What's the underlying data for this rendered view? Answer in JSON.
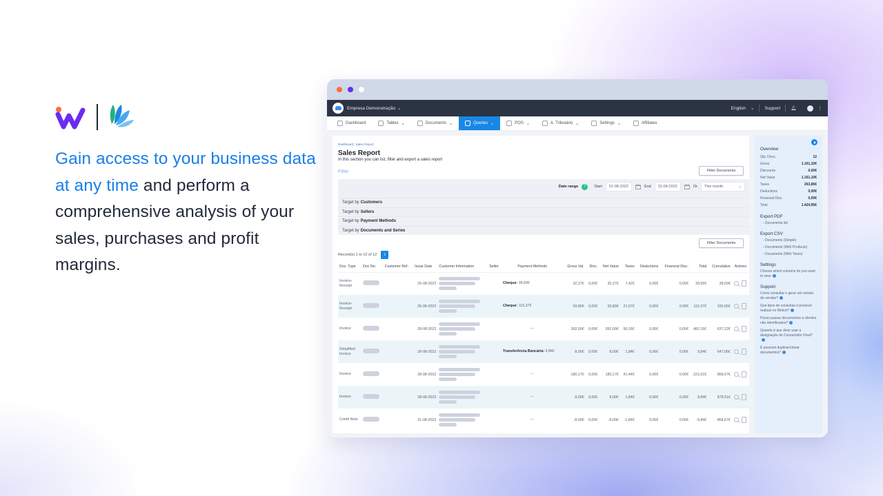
{
  "marketing": {
    "headline_highlight": "Gain access to your business data at any time",
    "headline_rest": " and perform a comprehensive analysis of your sales, purchases and profit margins.",
    "colors": {
      "highlight": "#1b7ee8",
      "text": "#232a3b",
      "brand_purple": "#6a2cf0",
      "brand_orange": "#ff6b35"
    }
  },
  "window": {
    "company": "Empresa Demonstração",
    "topnav": {
      "language": "English",
      "support": "Support"
    },
    "menu": [
      {
        "label": "Dashboard",
        "icon": "dashboard-icon",
        "dropdown": false,
        "active": false
      },
      {
        "label": "Tables",
        "icon": "users-icon",
        "dropdown": true,
        "active": false
      },
      {
        "label": "Documents",
        "icon": "document-icon",
        "dropdown": true,
        "active": false
      },
      {
        "label": "Queries",
        "icon": "bar-chart-icon",
        "dropdown": true,
        "active": true
      },
      {
        "label": "POS",
        "icon": "pos-icon",
        "dropdown": true,
        "active": false
      },
      {
        "label": "A. Tributário",
        "icon": "tax-icon",
        "dropdown": true,
        "active": false
      },
      {
        "label": "Settings",
        "icon": "settings-icon",
        "dropdown": true,
        "active": false
      },
      {
        "label": "Affiliates",
        "icon": "handshake-icon",
        "dropdown": false,
        "active": false
      }
    ],
    "breadcrumb": [
      "Dashboard",
      "Sales Report"
    ],
    "page_title": "Sales Report",
    "page_subtitle": "In this section you can list, filter and export a sales report",
    "filter_label": "Filter",
    "filter_button": "Filter Documents",
    "date_range": {
      "label": "Date range",
      "help": "?",
      "start_label": "Start",
      "start": "01-08-2022",
      "end_label": "End",
      "end": "31-08-2022",
      "or_label": "Or",
      "preset": "This month"
    },
    "targets": [
      {
        "prefix": "Target by",
        "label": "Customers"
      },
      {
        "prefix": "Target by",
        "label": "Sellers"
      },
      {
        "prefix": "Target by",
        "label": "Payment Methods"
      },
      {
        "prefix": "Target by",
        "label": "Documents and Series"
      }
    ],
    "records_text": "Record(s) 1 to 12 of 12",
    "current_page": "1",
    "table": {
      "columns": [
        "Doc. Type",
        "Doc No.",
        "Customer Ref.",
        "Issue Date",
        "Customer Information",
        "Seller",
        "Payment Methods",
        "Gross Val.",
        "Disc.",
        "Net Value",
        "Taxes",
        "Deductions",
        "Financial Disc.",
        "Total",
        "Cumulative",
        "Actions"
      ],
      "rows": [
        {
          "type": "Invoice-Receipt",
          "date": "25-08-2022",
          "pm_label": "Cheque:",
          "pm_value": "39,69€",
          "gross": "32,27€",
          "disc": "0,00€",
          "net": "32,27€",
          "taxes": "7,42€",
          "deductions": "0,00€",
          "fin_disc": "0,00€",
          "total": "39,69€",
          "cumulative": "39,69€"
        },
        {
          "type": "Invoice-Receipt",
          "date": "26-08-2022",
          "pm_label": "Cheque:",
          "pm_value": "115,37€",
          "gross": "93,80€",
          "disc": "0,00€",
          "net": "93,80€",
          "taxes": "21,57€",
          "deductions": "0,00€",
          "fin_disc": "0,00€",
          "total": "115,37€",
          "cumulative": "155,06€"
        },
        {
          "type": "Invoice",
          "date": "28-08-2022",
          "pm_label": "",
          "pm_value": "---",
          "gross": "392,00€",
          "disc": "0,00€",
          "net": "392,00€",
          "taxes": "90,16€",
          "deductions": "0,00€",
          "fin_disc": "0,00€",
          "total": "482,16€",
          "cumulative": "637,22€"
        },
        {
          "type": "Simplified Invoice",
          "date": "28-08-2022",
          "pm_label": "Transferência Bancária:",
          "pm_value": "9,84€",
          "gross": "8,00€",
          "disc": "0,00€",
          "net": "8,00€",
          "taxes": "1,84€",
          "deductions": "0,00€",
          "fin_disc": "0,00€",
          "total": "9,84€",
          "cumulative": "647,06€"
        },
        {
          "type": "Invoice",
          "date": "28-08-2022",
          "pm_label": "",
          "pm_value": "---",
          "gross": "180,17€",
          "disc": "0,00€",
          "net": "180,17€",
          "taxes": "41,44€",
          "deductions": "0,00€",
          "fin_disc": "0,00€",
          "total": "221,61€",
          "cumulative": "868,67€"
        },
        {
          "type": "Invoice",
          "date": "28-08-2022",
          "pm_label": "",
          "pm_value": "---",
          "gross": "8,00€",
          "disc": "0,00€",
          "net": "8,00€",
          "taxes": "1,84€",
          "deductions": "0,00€",
          "fin_disc": "0,00€",
          "total": "9,84€",
          "cumulative": "878,51€"
        },
        {
          "type": "Credit Note",
          "date": "31-08-2022",
          "pm_label": "",
          "pm_value": "---",
          "gross": "-8,00€",
          "disc": "0,00€",
          "net": "-8,00€",
          "taxes": "-1,84€",
          "deductions": "0,00€",
          "fin_disc": "0,00€",
          "total": "-9,84€",
          "cumulative": "868,67€"
        }
      ]
    },
    "sidebar": {
      "overview_title": "Overview",
      "overview": [
        {
          "label": "Qty. Docs.",
          "value": "12"
        },
        {
          "label": "Gross",
          "value": "1.161,10€"
        },
        {
          "label": "Discounts",
          "value": "0,00€"
        },
        {
          "label": "Net Value",
          "value": "1.161,10€"
        },
        {
          "label": "Taxes",
          "value": "263,85€"
        },
        {
          "label": "Deductions",
          "value": "0,00€"
        },
        {
          "label": "Financial Disc.",
          "value": "0,00€"
        },
        {
          "label": "Total",
          "value": "1.424,95€"
        }
      ],
      "export_pdf_title": "Export PDF",
      "export_pdf": [
        "- Documents list"
      ],
      "export_csv_title": "Export CSV",
      "export_csv": [
        "- Documents (Simple)",
        "- Documents (With Products)",
        "- Documents (With Taxes)"
      ],
      "settings_title": "Settings",
      "settings_text": "Choose which columns do you want to view",
      "support_title": "Support",
      "support": [
        "Como consultar e gerar um extrato de vendas?",
        "Que tipos de consultas é possível realizar no Moloni?",
        "Posso passar documentos a clientes não identificados?",
        "Quando é que deve usar a designação de Consumidor Final?",
        "É possível duplicar/clonar documentos?"
      ]
    }
  }
}
